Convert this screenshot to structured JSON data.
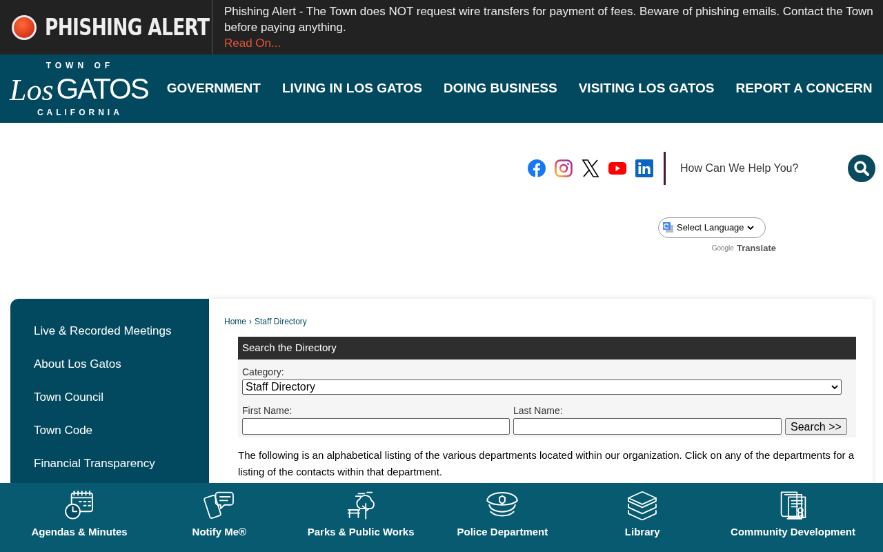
{
  "alert": {
    "title": "PHISHING ALERT",
    "message": "Phishing Alert - The Town does NOT request wire transfers for payment of fees. Beware of phishing emails. Contact the Town before paying anything.",
    "link": "Read On..."
  },
  "logo": {
    "top": "TOWN OF",
    "script": "Los",
    "main": "GATOS",
    "bottom": "CALIFORNIA"
  },
  "nav": [
    "GOVERNMENT",
    "LIVING IN LOS GATOS",
    "DOING BUSINESS",
    "VISITING LOS GATOS",
    "REPORT A CONCERN"
  ],
  "social": [
    {
      "kind": "facebook"
    },
    {
      "kind": "instagram"
    },
    {
      "kind": "x"
    },
    {
      "kind": "youtube"
    },
    {
      "kind": "linkedin"
    }
  ],
  "search": {
    "placeholder": "How Can We Help You?"
  },
  "translate": {
    "select": "Select Language",
    "powered": "Google",
    "label": "Translate"
  },
  "sidebar": {
    "items": [
      "Live & Recorded Meetings",
      "About Los Gatos",
      "Town Council",
      "Town Code",
      "Financial Transparency"
    ]
  },
  "breadcrumb": [
    "Home",
    "›",
    "Staff Directory"
  ],
  "directory": {
    "title": "Search the Directory",
    "category_label": "Category:",
    "category_value": "Staff Directory",
    "first_name_label": "First Name:",
    "last_name_label": "Last Name:",
    "search_button": "Search >>"
  },
  "intro": "The following is an alphabetical listing of the various departments located within our organization. Click on any of the departments for a listing of the contacts within that department.",
  "quick_links": [
    {
      "kind": "calendar",
      "label": "Agendas & Minutes"
    },
    {
      "kind": "phone",
      "label": "Notify Me®"
    },
    {
      "kind": "tree",
      "label": "Parks & Public Works"
    },
    {
      "kind": "police",
      "label": "Police Department"
    },
    {
      "kind": "books",
      "label": "Library"
    },
    {
      "kind": "certificate",
      "label": "Community Development"
    }
  ]
}
